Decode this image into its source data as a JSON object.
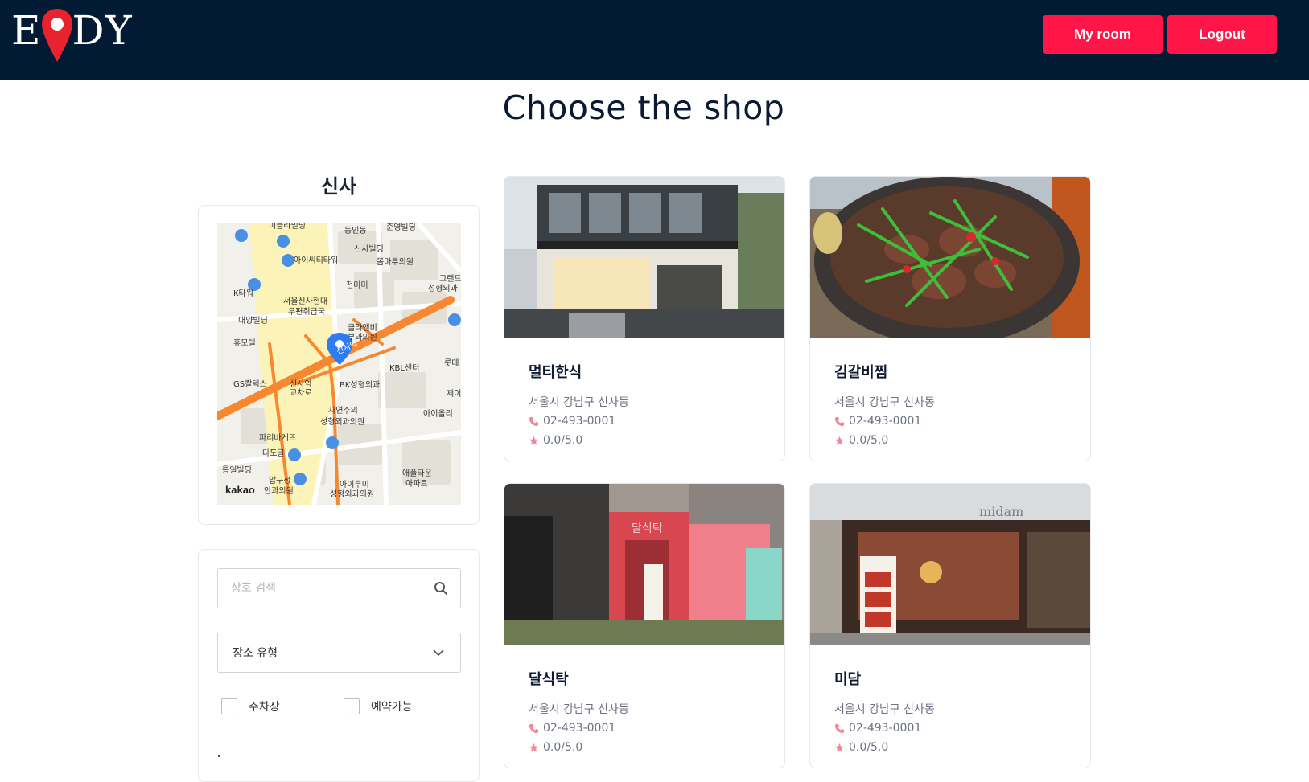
{
  "header": {
    "logo_text": "EDY",
    "logo_left": "E",
    "logo_right": "DY",
    "my_room_label": "My room",
    "logout_label": "Logout",
    "accent_color": "#ff1547",
    "bg_color": "#031a35"
  },
  "page": {
    "title": "Choose the shop"
  },
  "sidebar": {
    "region_name": "신사",
    "map": {
      "labels": [
        "미플라빌딩",
        "동인동",
        "준영빌딩",
        "신사빌딩",
        "아이씨티타워",
        "봄마루의원",
        "그랜드",
        "성형외과",
        "천미미",
        "K타워",
        "서울신사현대",
        "우편취급국",
        "대양빌딩",
        "클라앤비",
        "부과의원",
        "휴모텔",
        "신사역",
        "KBL센터",
        "롯데",
        "GS칼텍스",
        "신사역 교차로",
        "BK성형외과",
        "제이",
        "자연주의",
        "성형외과의원",
        "아이올리",
        "파리바게뜨",
        "다도글",
        "통일빌딩",
        "압구정",
        "안과의원",
        "아이루미",
        "성형외과의원",
        "애플타운",
        "아파트",
        "kakao"
      ],
      "brand": "kakao"
    },
    "search": {
      "placeholder": "상호 검색",
      "value": ""
    },
    "place_type": {
      "selected": "장소 유형"
    },
    "checkboxes": [
      {
        "label": "주차장",
        "checked": false
      },
      {
        "label": "예약가능",
        "checked": false
      }
    ]
  },
  "shops": [
    {
      "name": "멀티한식",
      "address": "서울시 강남구 신사동",
      "phone": "02-493-0001",
      "rating": "0.0/5.0"
    },
    {
      "name": "김갈비찜",
      "address": "서울시 강남구 신사동",
      "phone": "02-493-0001",
      "rating": "0.0/5.0"
    },
    {
      "name": "달식탁",
      "address": "서울시 강남구 신사동",
      "phone": "02-493-0001",
      "rating": "0.0/5.0"
    },
    {
      "name": "미담",
      "address": "서울시 강남구 신사동",
      "phone": "02-493-0001",
      "rating": "0.0/5.0"
    }
  ],
  "photo_signage": {
    "shop3_sign": "달식탁",
    "shop4_sign": "midam"
  }
}
